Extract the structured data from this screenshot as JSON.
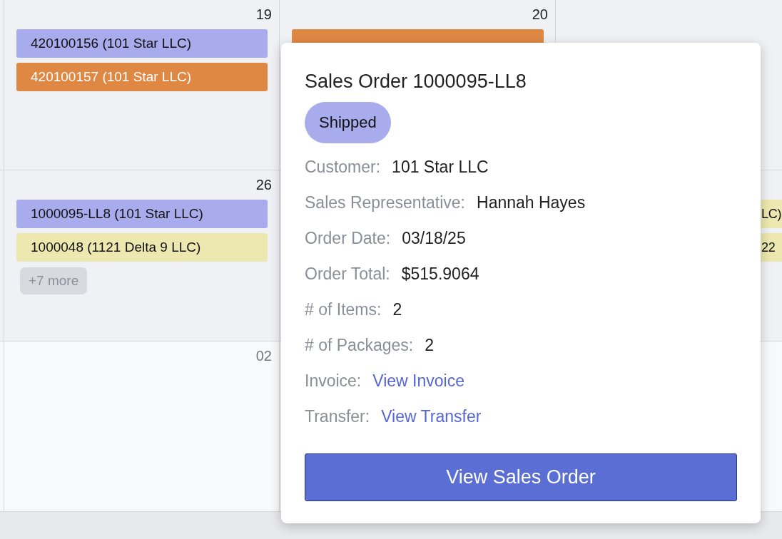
{
  "calendar": {
    "weeks": [
      {
        "outside_month": false,
        "days": [
          {
            "kind": "blank"
          },
          {
            "kind": "day",
            "date": "19",
            "events": [
              {
                "kind": "full",
                "label": "420100156 (101 Star LLC)",
                "color": "#a9acec"
              },
              {
                "kind": "full",
                "label": "420100157 (101 Star LLC)",
                "color": "#df8844"
              }
            ]
          },
          {
            "kind": "day",
            "date": "20",
            "events": [
              {
                "kind": "covered",
                "color": "#df8844"
              }
            ]
          },
          {
            "kind": "blank"
          }
        ]
      },
      {
        "outside_month": false,
        "days": [
          {
            "kind": "blank"
          },
          {
            "kind": "day",
            "date": "26",
            "events": [
              {
                "kind": "full",
                "label": "1000095-LL8 (101 Star LLC)",
                "color": "#a9acec"
              },
              {
                "kind": "full",
                "label": "1000048 (1121 Delta 9 LLC)",
                "color": "#ede7b0"
              }
            ],
            "more": "+7 more"
          },
          {
            "kind": "blank"
          },
          {
            "kind": "day",
            "events": [
              {
                "kind": "partial",
                "label": "LC)",
                "color": "#ede7b0"
              },
              {
                "kind": "partial",
                "label": "22",
                "color": "#ede7b0"
              }
            ]
          }
        ]
      },
      {
        "outside_month": true,
        "days": [
          {
            "kind": "blank"
          },
          {
            "kind": "day",
            "date": "02"
          },
          {
            "kind": "blank"
          },
          {
            "kind": "blank"
          }
        ]
      }
    ]
  },
  "popover": {
    "title": "Sales Order 1000095-LL8",
    "status": "Shipped",
    "fields": [
      {
        "kind": "text",
        "label": "Customer:",
        "value": "101 Star LLC"
      },
      {
        "kind": "text",
        "label": "Sales Representative:",
        "value": "Hannah Hayes"
      },
      {
        "kind": "text",
        "label": "Order Date:",
        "value": "03/18/25"
      },
      {
        "kind": "text",
        "label": "Order Total:",
        "value": "$515.9064"
      },
      {
        "kind": "text",
        "label": "# of Items:",
        "value": "2"
      },
      {
        "kind": "text",
        "label": "# of Packages:",
        "value": "2"
      },
      {
        "kind": "link",
        "label": "Invoice:",
        "value": "View Invoice"
      },
      {
        "kind": "link",
        "label": "Transfer:",
        "value": "View Transfer"
      }
    ],
    "button": "View Sales Order"
  }
}
